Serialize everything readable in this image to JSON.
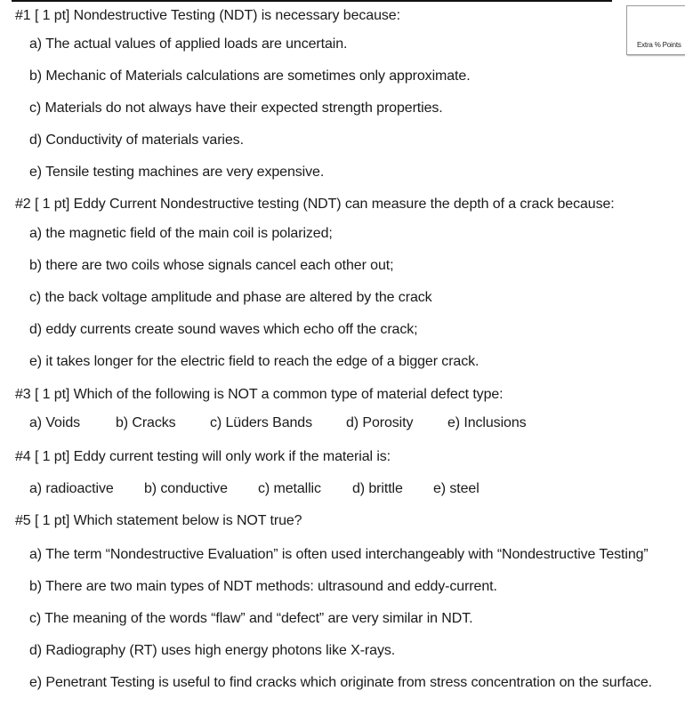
{
  "extra_box": {
    "label": "Extra % Points"
  },
  "questions": [
    {
      "header": "#1 [ 1 pt]  Nondestructive Testing (NDT) is necessary because:",
      "options": [
        "a)  The actual values of applied loads are uncertain.",
        "b)  Mechanic of Materials calculations are sometimes only approximate.",
        "c)  Materials do not always have their expected strength properties.",
        "d)  Conductivity of materials varies.",
        "e)  Tensile testing machines are very expensive."
      ]
    },
    {
      "header": "#2 [ 1 pt]  Eddy Current Nondestructive testing (NDT) can measure the depth of a crack because:",
      "options": [
        "a)  the magnetic field of the main coil is polarized;",
        "b)  there are two coils whose signals cancel each other out;",
        "c)  the back voltage amplitude and phase are altered by the crack",
        "d)  eddy currents create sound waves which echo off the crack;",
        "e)  it takes longer for the electric field to reach the edge of a bigger crack."
      ]
    },
    {
      "header": "#3 [ 1 pt]  Which of the following is NOT a common type of material defect type:",
      "options": [
        "a)  Voids",
        "b)  Cracks",
        "c)  Lüders Bands",
        "d)  Porosity",
        "e)  Inclusions"
      ]
    },
    {
      "header": "#4 [ 1 pt]  Eddy current testing will only work if the material is:",
      "options": [
        "a)  radioactive",
        "b)  conductive",
        "c)  metallic",
        "d)  brittle",
        "e)   steel"
      ]
    },
    {
      "header": "#5 [ 1 pt]  Which statement below is NOT true?",
      "options": [
        "a) The term “Nondestructive Evaluation” is often used interchangeably with “Nondestructive Testing”",
        "b)  There are two main types of NDT methods: ultrasound and eddy-current.",
        "c)  The meaning of the words “flaw” and “defect” are very similar in NDT.",
        "d)  Radiography (RT) uses high energy photons like X-rays.",
        "e)  Penetrant Testing is useful to find cracks which originate from stress concentration on the surface."
      ]
    }
  ]
}
